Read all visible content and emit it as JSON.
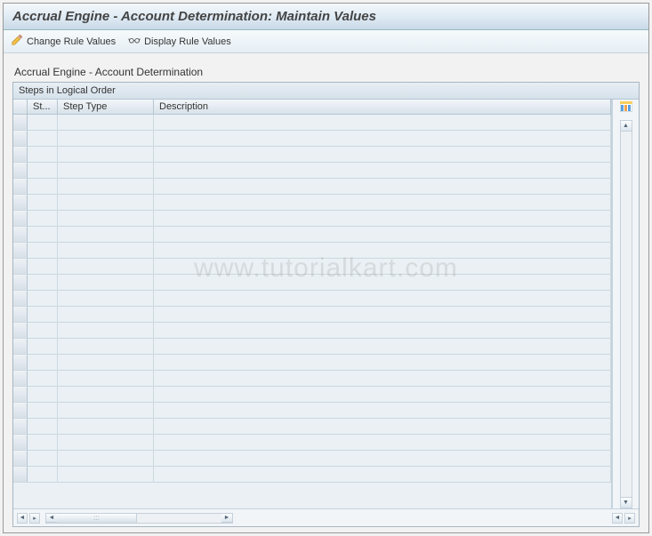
{
  "title": "Accrual Engine - Account Determination: Maintain Values",
  "toolbar": {
    "change_label": "Change Rule Values",
    "display_label": "Display Rule Values"
  },
  "section_label": "Accrual Engine - Account Determination",
  "table": {
    "title": "Steps in Logical Order",
    "columns": {
      "st": "St...",
      "step_type": "Step Type",
      "description": "Description"
    },
    "rows": [
      {
        "st": "",
        "step_type": "",
        "description": ""
      },
      {
        "st": "",
        "step_type": "",
        "description": ""
      },
      {
        "st": "",
        "step_type": "",
        "description": ""
      },
      {
        "st": "",
        "step_type": "",
        "description": ""
      },
      {
        "st": "",
        "step_type": "",
        "description": ""
      },
      {
        "st": "",
        "step_type": "",
        "description": ""
      },
      {
        "st": "",
        "step_type": "",
        "description": ""
      },
      {
        "st": "",
        "step_type": "",
        "description": ""
      },
      {
        "st": "",
        "step_type": "",
        "description": ""
      },
      {
        "st": "",
        "step_type": "",
        "description": ""
      },
      {
        "st": "",
        "step_type": "",
        "description": ""
      },
      {
        "st": "",
        "step_type": "",
        "description": ""
      },
      {
        "st": "",
        "step_type": "",
        "description": ""
      },
      {
        "st": "",
        "step_type": "",
        "description": ""
      },
      {
        "st": "",
        "step_type": "",
        "description": ""
      },
      {
        "st": "",
        "step_type": "",
        "description": ""
      },
      {
        "st": "",
        "step_type": "",
        "description": ""
      },
      {
        "st": "",
        "step_type": "",
        "description": ""
      },
      {
        "st": "",
        "step_type": "",
        "description": ""
      },
      {
        "st": "",
        "step_type": "",
        "description": ""
      },
      {
        "st": "",
        "step_type": "",
        "description": ""
      },
      {
        "st": "",
        "step_type": "",
        "description": ""
      },
      {
        "st": "",
        "step_type": "",
        "description": ""
      }
    ]
  },
  "watermark": "www.tutorialkart.com"
}
